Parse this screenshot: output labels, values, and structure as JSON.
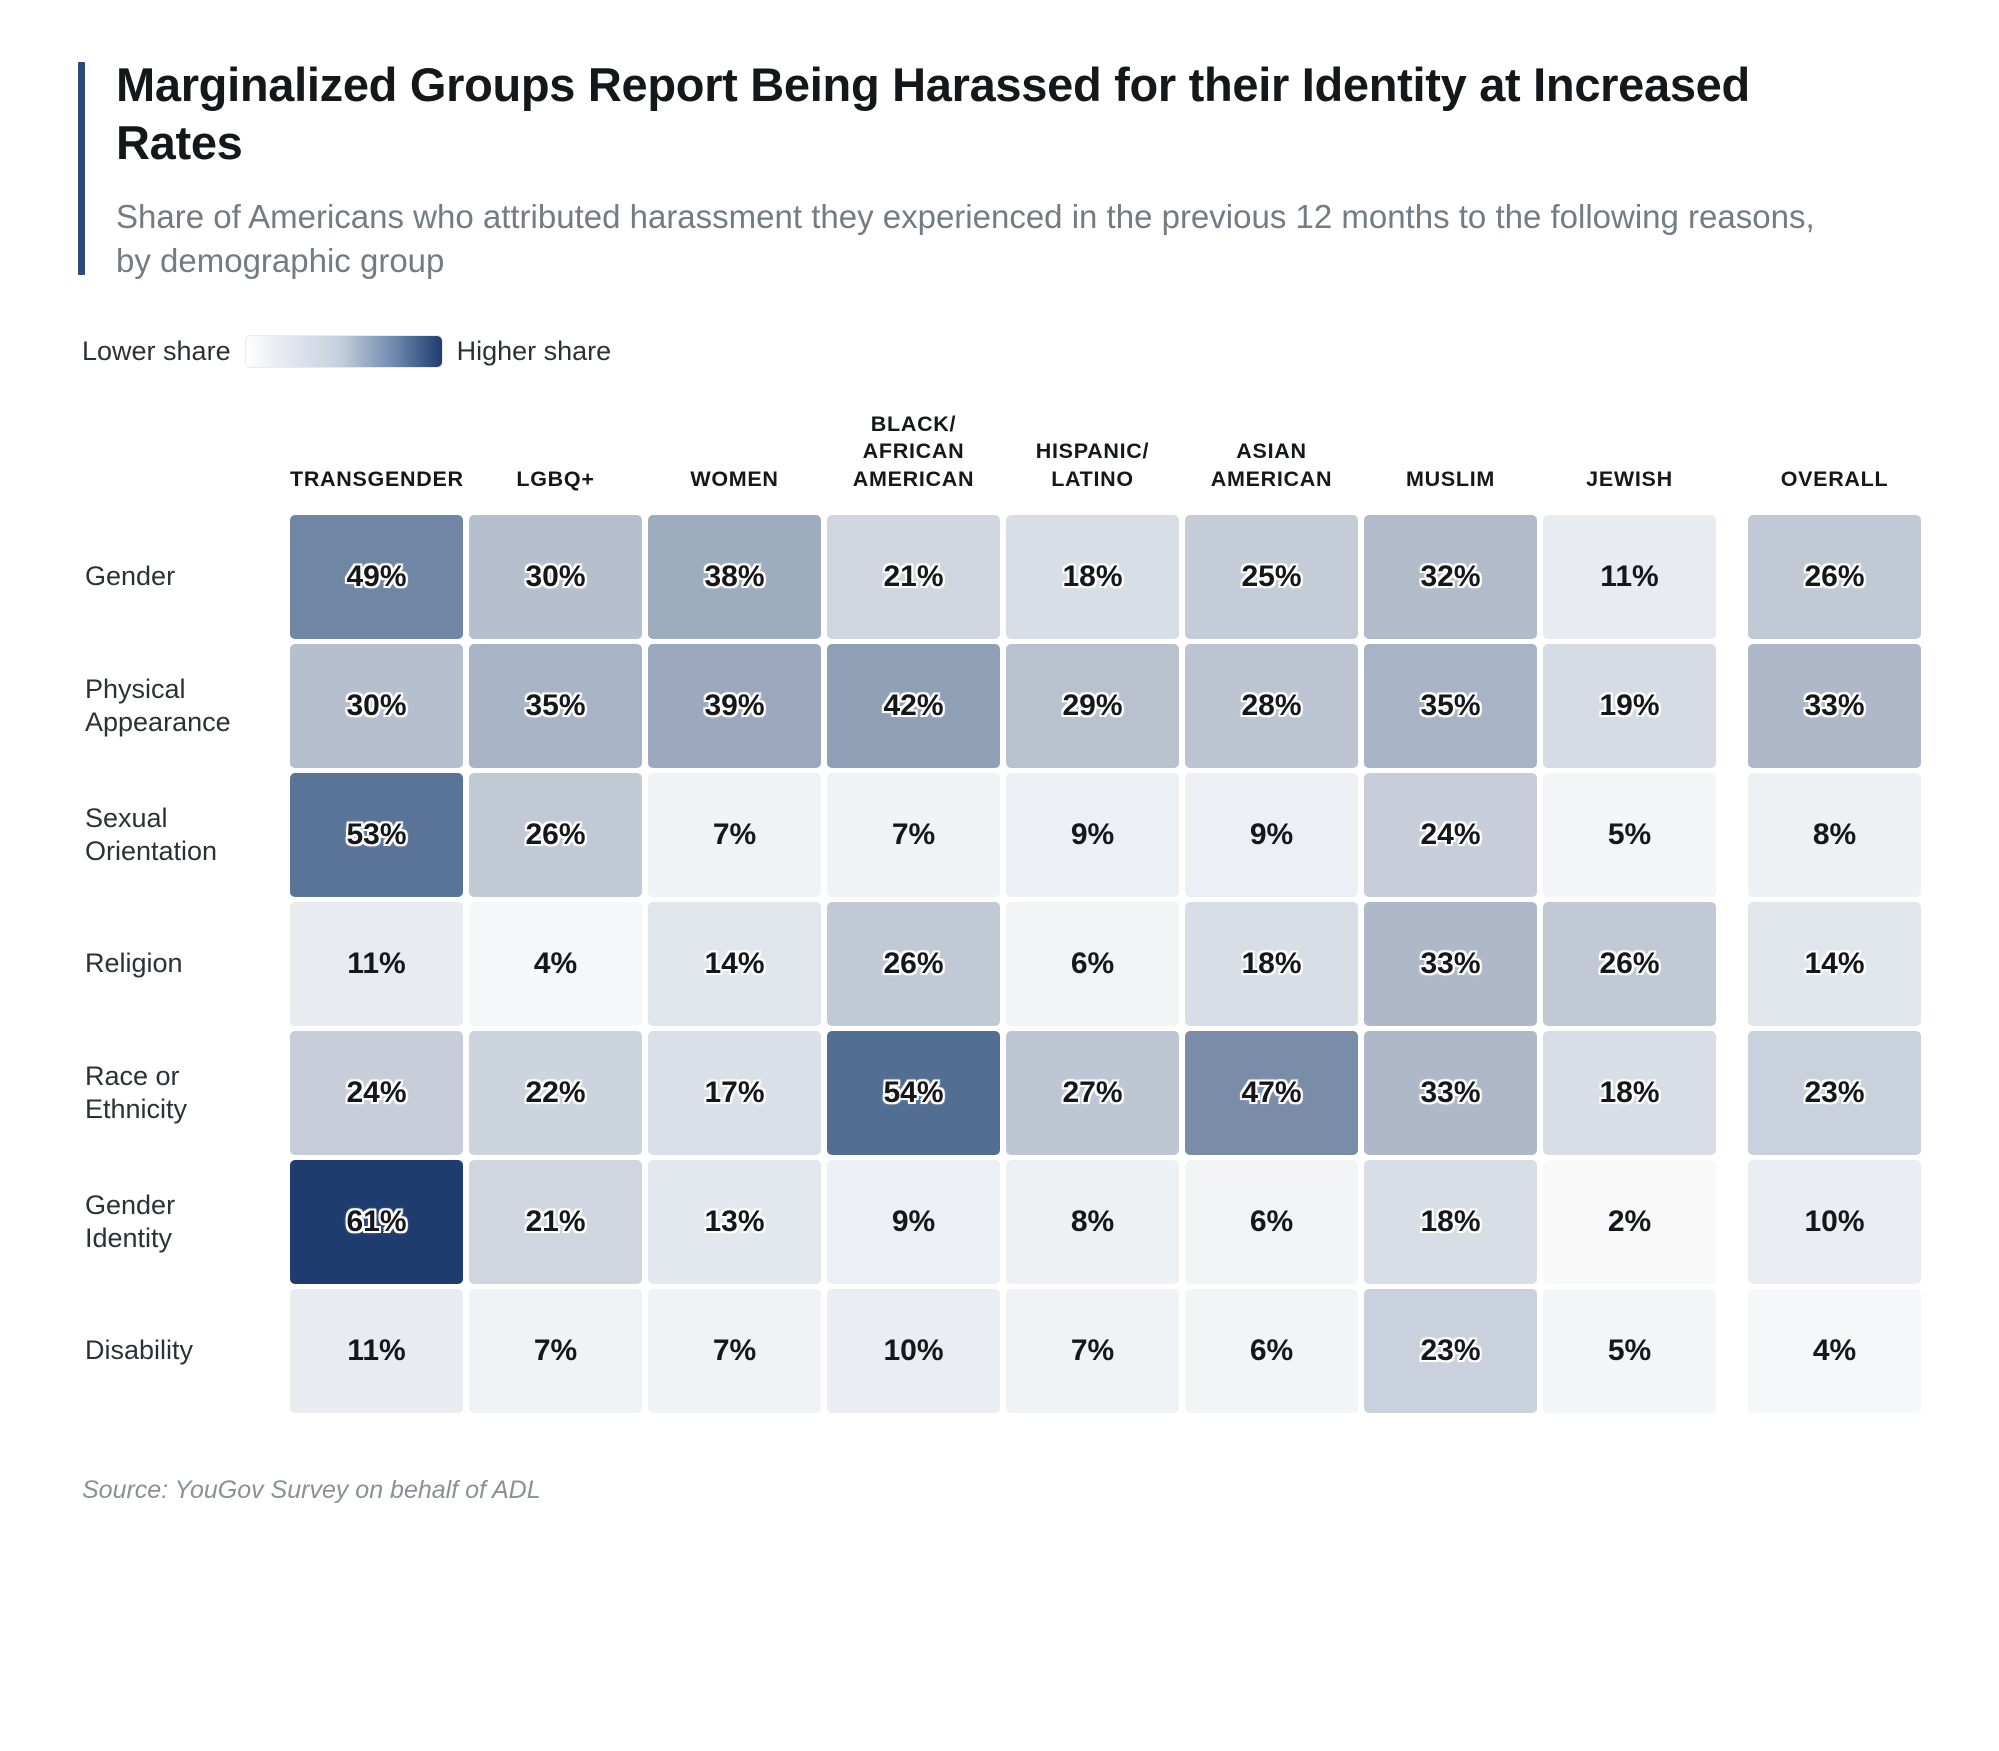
{
  "header": {
    "title": "Marginalized Groups Report Being Harassed for their Identity at Increased Rates",
    "subtitle": "Share of Americans who attributed harassment they experienced in the previous 12 months to the following reasons, by demographic group"
  },
  "legend": {
    "low_label": "Lower share",
    "high_label": "Higher share",
    "gradient_low_color": "#ffffff",
    "gradient_high_color": "#1e3c6e"
  },
  "source": {
    "text": "Source: YouGov Survey on behalf of ADL"
  },
  "colors": {
    "accent_rule": "#2b4a78",
    "title": "#15171a",
    "subtitle": "#737b83",
    "scale_min": "#fafbfc",
    "scale_max": "#1e3c6e"
  },
  "chart_data": {
    "type": "heatmap",
    "title": "Marginalized Groups Report Being Harassed for their Identity at Increased Rates",
    "subtitle": "Share of Americans who attributed harassment they experienced in the previous 12 months to the following reasons, by demographic group",
    "xlabel": "",
    "ylabel": "",
    "value_unit": "%",
    "value_suffix": "%",
    "zlim": [
      0,
      61
    ],
    "legend": "gradient bar, left = lower share, right = higher share",
    "columns": [
      "TRANSGENDER",
      "LGBQ+",
      "WOMEN",
      "BLACK/\nAFRICAN\nAMERICAN",
      "HISPANIC/\nLATINO",
      "ASIAN\nAMERICAN",
      "MUSLIM",
      "JEWISH",
      "OVERALL"
    ],
    "rows": [
      "Gender",
      "Physical\nAppearance",
      "Sexual\nOrientation",
      "Religion",
      "Race or\nEthnicity",
      "Gender\nIdentity",
      "Disability"
    ],
    "values": [
      [
        49,
        30,
        38,
        21,
        18,
        25,
        32,
        11,
        26
      ],
      [
        30,
        35,
        39,
        42,
        29,
        28,
        35,
        19,
        33
      ],
      [
        53,
        26,
        7,
        7,
        9,
        9,
        24,
        5,
        8
      ],
      [
        11,
        4,
        14,
        26,
        6,
        18,
        33,
        26,
        14
      ],
      [
        24,
        22,
        17,
        54,
        27,
        47,
        33,
        18,
        23
      ],
      [
        61,
        21,
        13,
        9,
        8,
        6,
        18,
        2,
        10
      ],
      [
        11,
        7,
        7,
        10,
        7,
        6,
        23,
        5,
        4
      ]
    ],
    "cell_labels": [
      [
        "49%",
        "30%",
        "38%",
        "21%",
        "18%",
        "25%",
        "32%",
        "11%",
        "26%"
      ],
      [
        "30%",
        "35%",
        "39%",
        "42%",
        "29%",
        "28%",
        "35%",
        "19%",
        "33%"
      ],
      [
        "53%",
        "26%",
        "7%",
        "7%",
        "9%",
        "9%",
        "24%",
        "5%",
        "8%"
      ],
      [
        "11%",
        "4%",
        "14%",
        "26%",
        "6%",
        "18%",
        "33%",
        "26%",
        "14%"
      ],
      [
        "24%",
        "22%",
        "17%",
        "54%",
        "27%",
        "47%",
        "33%",
        "18%",
        "23%"
      ],
      [
        "61%",
        "21%",
        "13%",
        "9%",
        "8%",
        "6%",
        "18%",
        "2%",
        "10%"
      ],
      [
        "11%",
        "7%",
        "7%",
        "10%",
        "7%",
        "6%",
        "23%",
        "5%",
        "4%"
      ]
    ]
  }
}
